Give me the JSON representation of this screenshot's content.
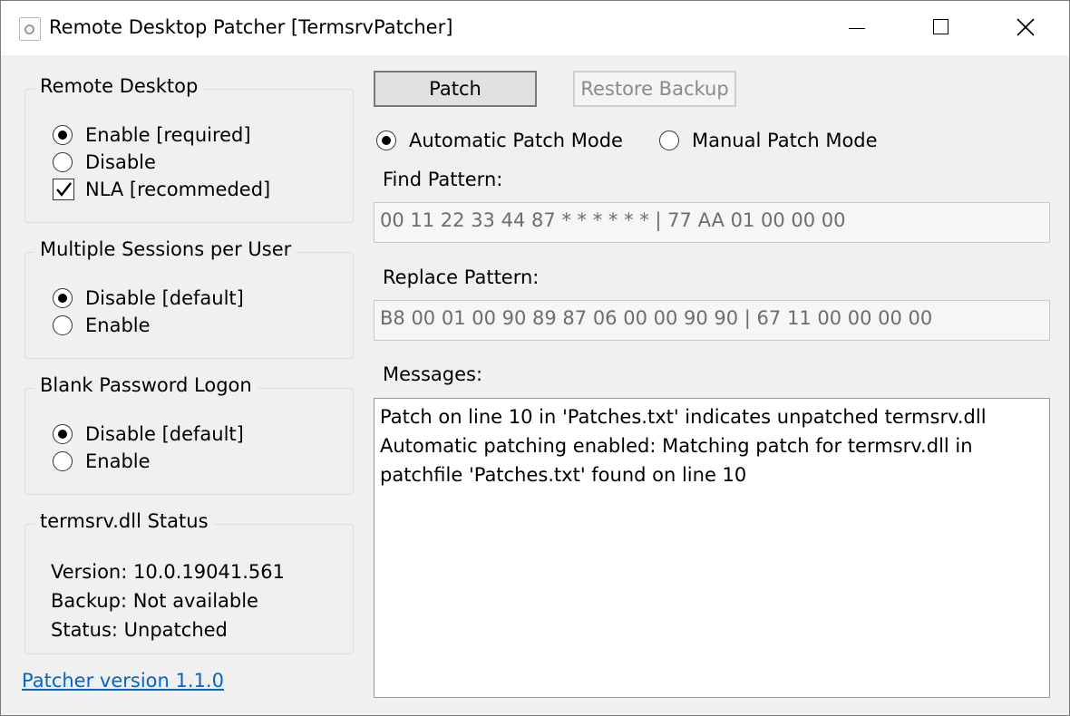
{
  "window": {
    "title": "Remote Desktop Patcher [TermsrvPatcher]"
  },
  "remote_desktop": {
    "title": "Remote Desktop",
    "enable_label": "Enable [required]",
    "disable_label": "Disable",
    "nla_label": "NLA [recommeded]",
    "selected": "Enable [required]",
    "nla_checked": true
  },
  "multiple_sessions": {
    "title": "Multiple Sessions per User",
    "disable_label": "Disable [default]",
    "enable_label": "Enable",
    "selected": "Disable [default]"
  },
  "blank_password": {
    "title": "Blank Password Logon",
    "disable_label": "Disable [default]",
    "enable_label": "Enable",
    "selected": "Disable [default]"
  },
  "status": {
    "title": "termsrv.dll Status",
    "version": "Version: 10.0.19041.561",
    "backup": "Backup: Not available",
    "state": "Status: Unpatched"
  },
  "footer": {
    "version_link": "Patcher version 1.1.0"
  },
  "toolbar": {
    "patch_label": "Patch",
    "restore_label": "Restore Backup"
  },
  "mode": {
    "automatic_label": "Automatic Patch Mode",
    "manual_label": "Manual Patch Mode",
    "selected": "Automatic Patch Mode"
  },
  "find": {
    "label": "Find Pattern:",
    "value": "00 11 22 33 44 87 * * * * * * | 77 AA 01 00 00 00"
  },
  "replace": {
    "label": "Replace Pattern:",
    "value": "B8 00 01 00 90 89 87 06 00 00 90 90 | 67 11 00 00 00 00"
  },
  "messages": {
    "label": "Messages:",
    "lines": [
      "Patch on line 10 in 'Patches.txt' indicates unpatched termsrv.dll",
      "Automatic patching enabled: Matching patch for termsrv.dll in",
      "patchfile 'Patches.txt' found on line 10"
    ]
  }
}
